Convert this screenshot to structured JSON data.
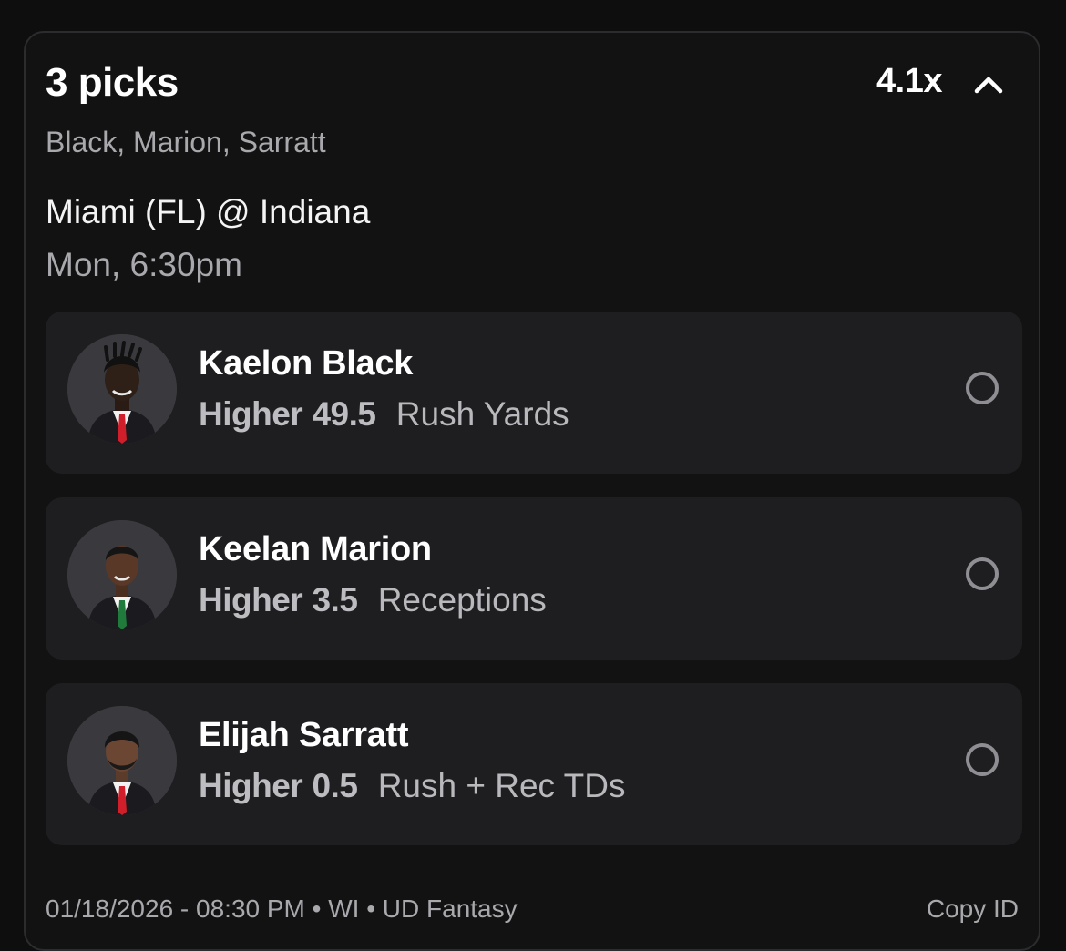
{
  "header": {
    "title": "3 picks",
    "multiplier": "4.1x",
    "players_summary": "Black, Marion, Sarratt"
  },
  "game": {
    "matchup": "Miami (FL) @ Indiana",
    "time": "Mon, 6:30pm"
  },
  "picks": [
    {
      "player": "Kaelon Black",
      "direction": "Higher",
      "line": "49.5",
      "stat": "Rush Yards",
      "tie_color": "#d01f2a"
    },
    {
      "player": "Keelan Marion",
      "direction": "Higher",
      "line": "3.5",
      "stat": "Receptions",
      "tie_color": "#1f7a3c"
    },
    {
      "player": "Elijah Sarratt",
      "direction": "Higher",
      "line": "0.5",
      "stat": "Rush + Rec TDs",
      "tie_color": "#d01f2a"
    }
  ],
  "footer": {
    "meta": "01/18/2026 - 08:30 PM • WI • UD Fantasy",
    "copy_id": "Copy ID"
  },
  "icons": {
    "collapse": "chevron-up-icon",
    "select": "radio-circle-icon",
    "avatar": "player-headshot"
  }
}
